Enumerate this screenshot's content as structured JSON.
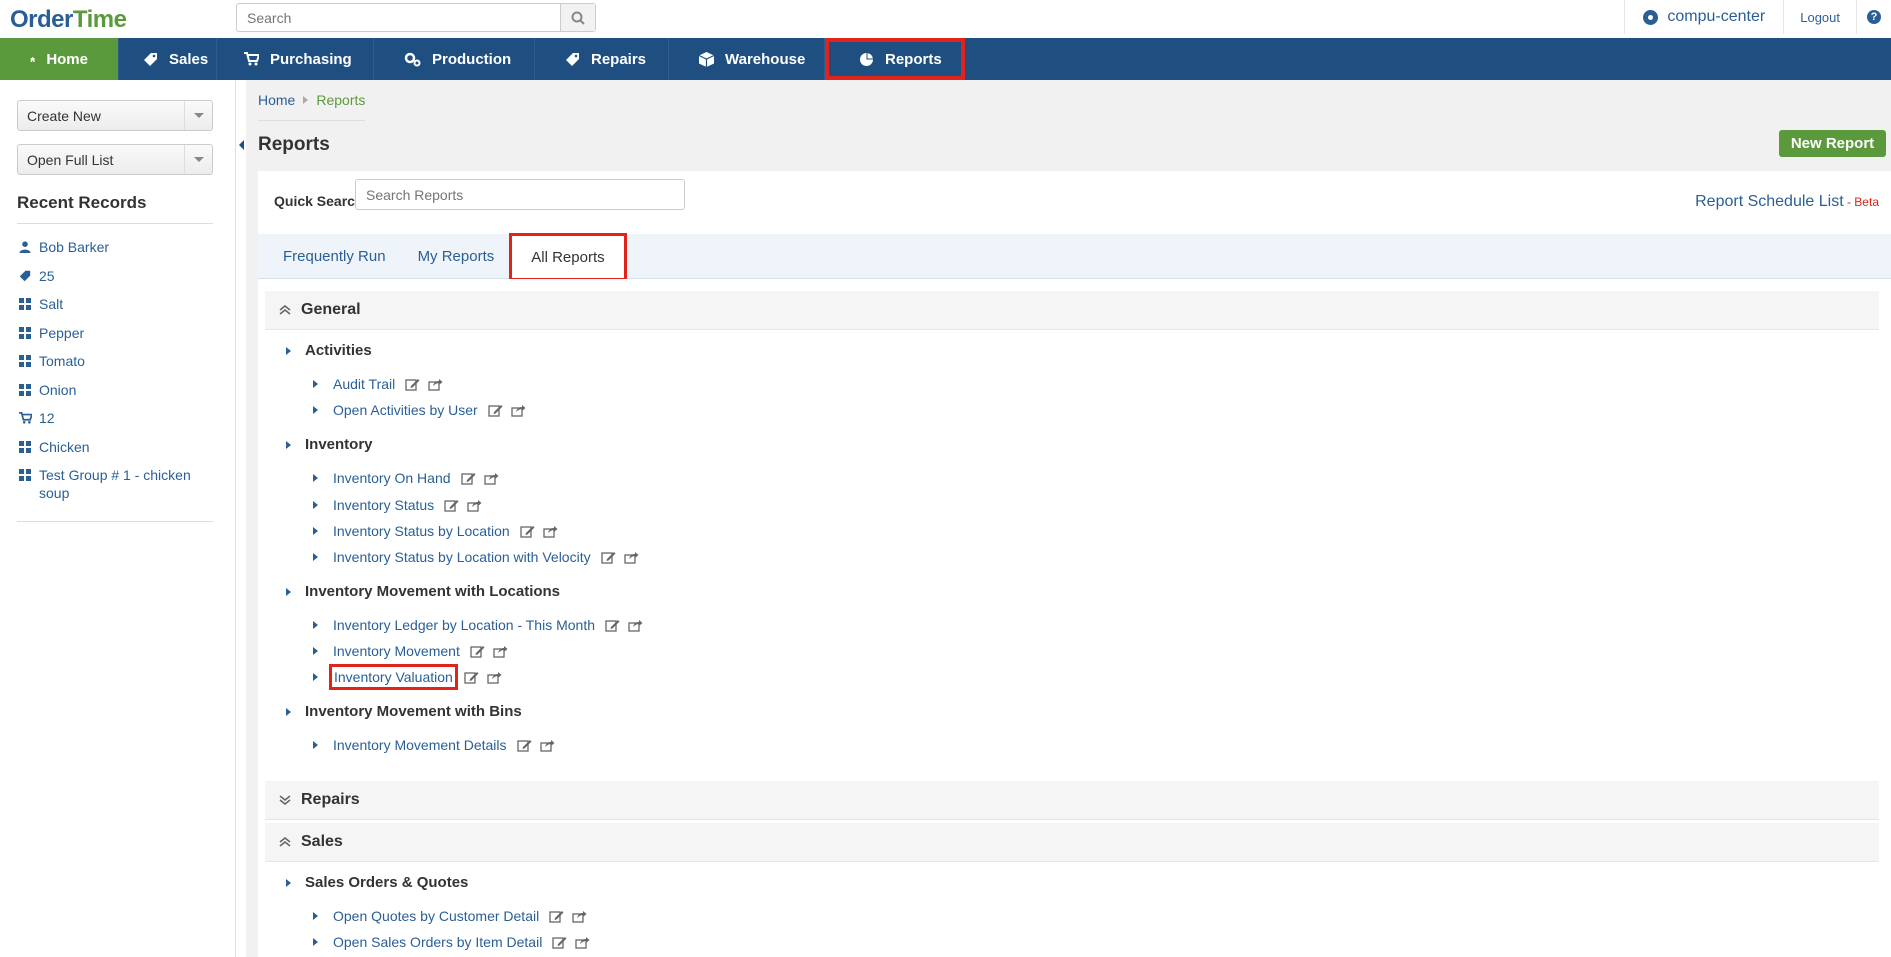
{
  "app": {
    "logo_prefix": "O",
    "logo_mid": "rder",
    "logo_suffix": "Time"
  },
  "header": {
    "search_placeholder": "Search",
    "company": "compu-center",
    "logout": "Logout",
    "help": "?"
  },
  "nav": {
    "items": [
      {
        "label": "Home",
        "icon": "home-icon"
      },
      {
        "label": "Sales",
        "icon": "tag-icon"
      },
      {
        "label": "Purchasing",
        "icon": "cart-icon"
      },
      {
        "label": "Production",
        "icon": "gears-icon"
      },
      {
        "label": "Repairs",
        "icon": "wrench-icon"
      },
      {
        "label": "Warehouse",
        "icon": "box-icon"
      },
      {
        "label": "Reports",
        "icon": "pie-chart-icon"
      }
    ],
    "active": "Home",
    "highlighted": "Reports"
  },
  "sidebar": {
    "create_new": "Create New",
    "open_full_list": "Open Full List",
    "recent_title": "Recent Records",
    "recent": [
      {
        "label": "Bob Barker",
        "icon": "person-icon"
      },
      {
        "label": "25",
        "icon": "tag-icon"
      },
      {
        "label": "Salt",
        "icon": "grid-icon"
      },
      {
        "label": "Pepper",
        "icon": "grid-icon"
      },
      {
        "label": "Tomato",
        "icon": "grid-icon"
      },
      {
        "label": "Onion",
        "icon": "grid-icon"
      },
      {
        "label": "12",
        "icon": "cart-icon"
      },
      {
        "label": "Chicken",
        "icon": "grid-icon"
      },
      {
        "label": "Test Group # 1 - chicken soup",
        "icon": "grid-icon"
      }
    ]
  },
  "main": {
    "breadcrumb": {
      "home": "Home",
      "current": "Reports"
    },
    "title": "Reports",
    "new_report": "New Report",
    "quick_search_label": "Quick Search",
    "quick_search_placeholder": "Search Reports",
    "schedule_link": "Report Schedule List",
    "schedule_beta": " - Beta",
    "tabs": [
      "Frequently Run",
      "My Reports",
      "All Reports"
    ],
    "active_tab": "All Reports"
  },
  "reports": {
    "sections": [
      {
        "title": "General",
        "expanded": true,
        "groups": [
          {
            "title": "Activities",
            "items": [
              "Audit Trail",
              "Open Activities by User"
            ]
          },
          {
            "title": "Inventory",
            "items": [
              "Inventory On Hand",
              "Inventory Status",
              "Inventory Status by Location",
              "Inventory Status by Location with Velocity"
            ]
          },
          {
            "title": "Inventory Movement with Locations",
            "items": [
              "Inventory Ledger by Location - This Month",
              "Inventory Movement",
              "Inventory Valuation"
            ]
          },
          {
            "title": "Inventory Movement with Bins",
            "items": [
              "Inventory Movement Details"
            ]
          }
        ]
      },
      {
        "title": "Repairs",
        "expanded": false,
        "groups": []
      },
      {
        "title": "Sales",
        "expanded": true,
        "groups": [
          {
            "title": "Sales Orders & Quotes",
            "items": [
              "Open Quotes by Customer Detail",
              "Open Sales Orders by Item Detail"
            ]
          }
        ]
      }
    ],
    "highlighted_item": "Inventory Valuation"
  },
  "colors": {
    "nav_bg": "#1f4e80",
    "active_green": "#5b9a3c",
    "link_blue": "#2a5f96",
    "highlight_red": "#e0241b"
  }
}
